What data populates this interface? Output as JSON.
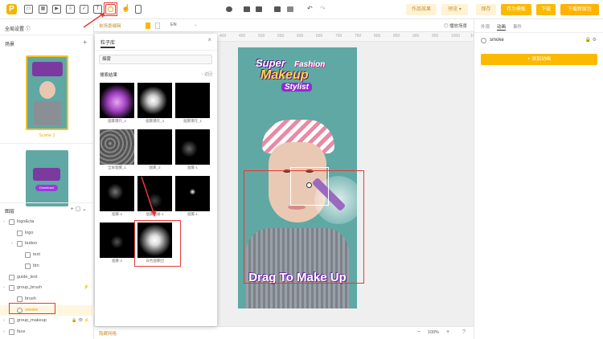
{
  "toolbar": {
    "logo": "P",
    "icons": [
      "image-icon",
      "grid-icon",
      "video-icon",
      "import-icon",
      "checkbox-icon",
      "text-icon",
      "particle-icon",
      "hand-icon",
      "phone-icon"
    ],
    "text_icon_glyph": "T",
    "works_effect": "作品效果",
    "preview": "预览 ▾",
    "save": "保存",
    "save_as_template": "存为模板",
    "download": "下载",
    "download_single": "下载新版包"
  },
  "left": {
    "global_settings": "全局设置 ⓘ",
    "scenes_title": "场景",
    "scene1_label": "Scene 1",
    "download_badge": "Download",
    "layers_title": "图层",
    "layers": [
      {
        "label": "logo&cta",
        "indent": 0,
        "type": "folder"
      },
      {
        "label": "logo",
        "indent": 1,
        "type": "image"
      },
      {
        "label": "button",
        "indent": 1,
        "type": "folder"
      },
      {
        "label": "text",
        "indent": 2,
        "type": "text"
      },
      {
        "label": "btn",
        "indent": 2,
        "type": "image"
      },
      {
        "label": "guide_text",
        "indent": 0,
        "type": "image"
      },
      {
        "label": "group_brush",
        "indent": 0,
        "type": "folder"
      },
      {
        "label": "brush",
        "indent": 1,
        "type": "image"
      },
      {
        "label": "smoke",
        "indent": 1,
        "type": "particle"
      },
      {
        "label": "group_makeup",
        "indent": 0,
        "type": "folder"
      },
      {
        "label": "face",
        "indent": 0,
        "type": "folder"
      }
    ]
  },
  "canvas": {
    "tab_label": "单场景编辑",
    "lang": "EN",
    "play_scene": "◎ 播放场景",
    "ruler": [
      "200",
      "250",
      "300",
      "350",
      "400",
      "450",
      "500",
      "550",
      "600",
      "650",
      "700",
      "750",
      "800",
      "850",
      "900",
      "950",
      "1000",
      "1050",
      "1100",
      "1150",
      "1200",
      "125"
    ],
    "ad_title_1": "Super",
    "ad_title_2": "Fashion",
    "ad_title_3": "Makeup",
    "ad_title_4": "Stylist",
    "guide_text": "Drag To Make Up",
    "zoom": "100%",
    "status_left": "隐藏网格"
  },
  "popup": {
    "title": "粒子库",
    "search_value": "烟雾",
    "results_label": "搜索结果",
    "back": "‹ 返回",
    "items": [
      {
        "label": "烟雾爆炸_2"
      },
      {
        "label": "烟雾爆炸_3"
      },
      {
        "label": "烟雾爆炸_1"
      },
      {
        "label": "全屏烟雾_1"
      },
      {
        "label": "烟雾_3"
      },
      {
        "label": "烟雾-1"
      },
      {
        "label": "烟雾-2"
      },
      {
        "label": "烟雾拖尾-1"
      },
      {
        "label": "烟雾-1"
      },
      {
        "label": "烟雾-2"
      },
      {
        "label": "白色烟雾团"
      }
    ]
  },
  "right": {
    "tabs": [
      "外观",
      "动画",
      "事件"
    ],
    "layer_name": "smoke",
    "add_animation": "+ 添加动画"
  },
  "colors": {
    "accent": "#fbb900",
    "red": "#e53935",
    "teal": "#5fa8a4"
  }
}
